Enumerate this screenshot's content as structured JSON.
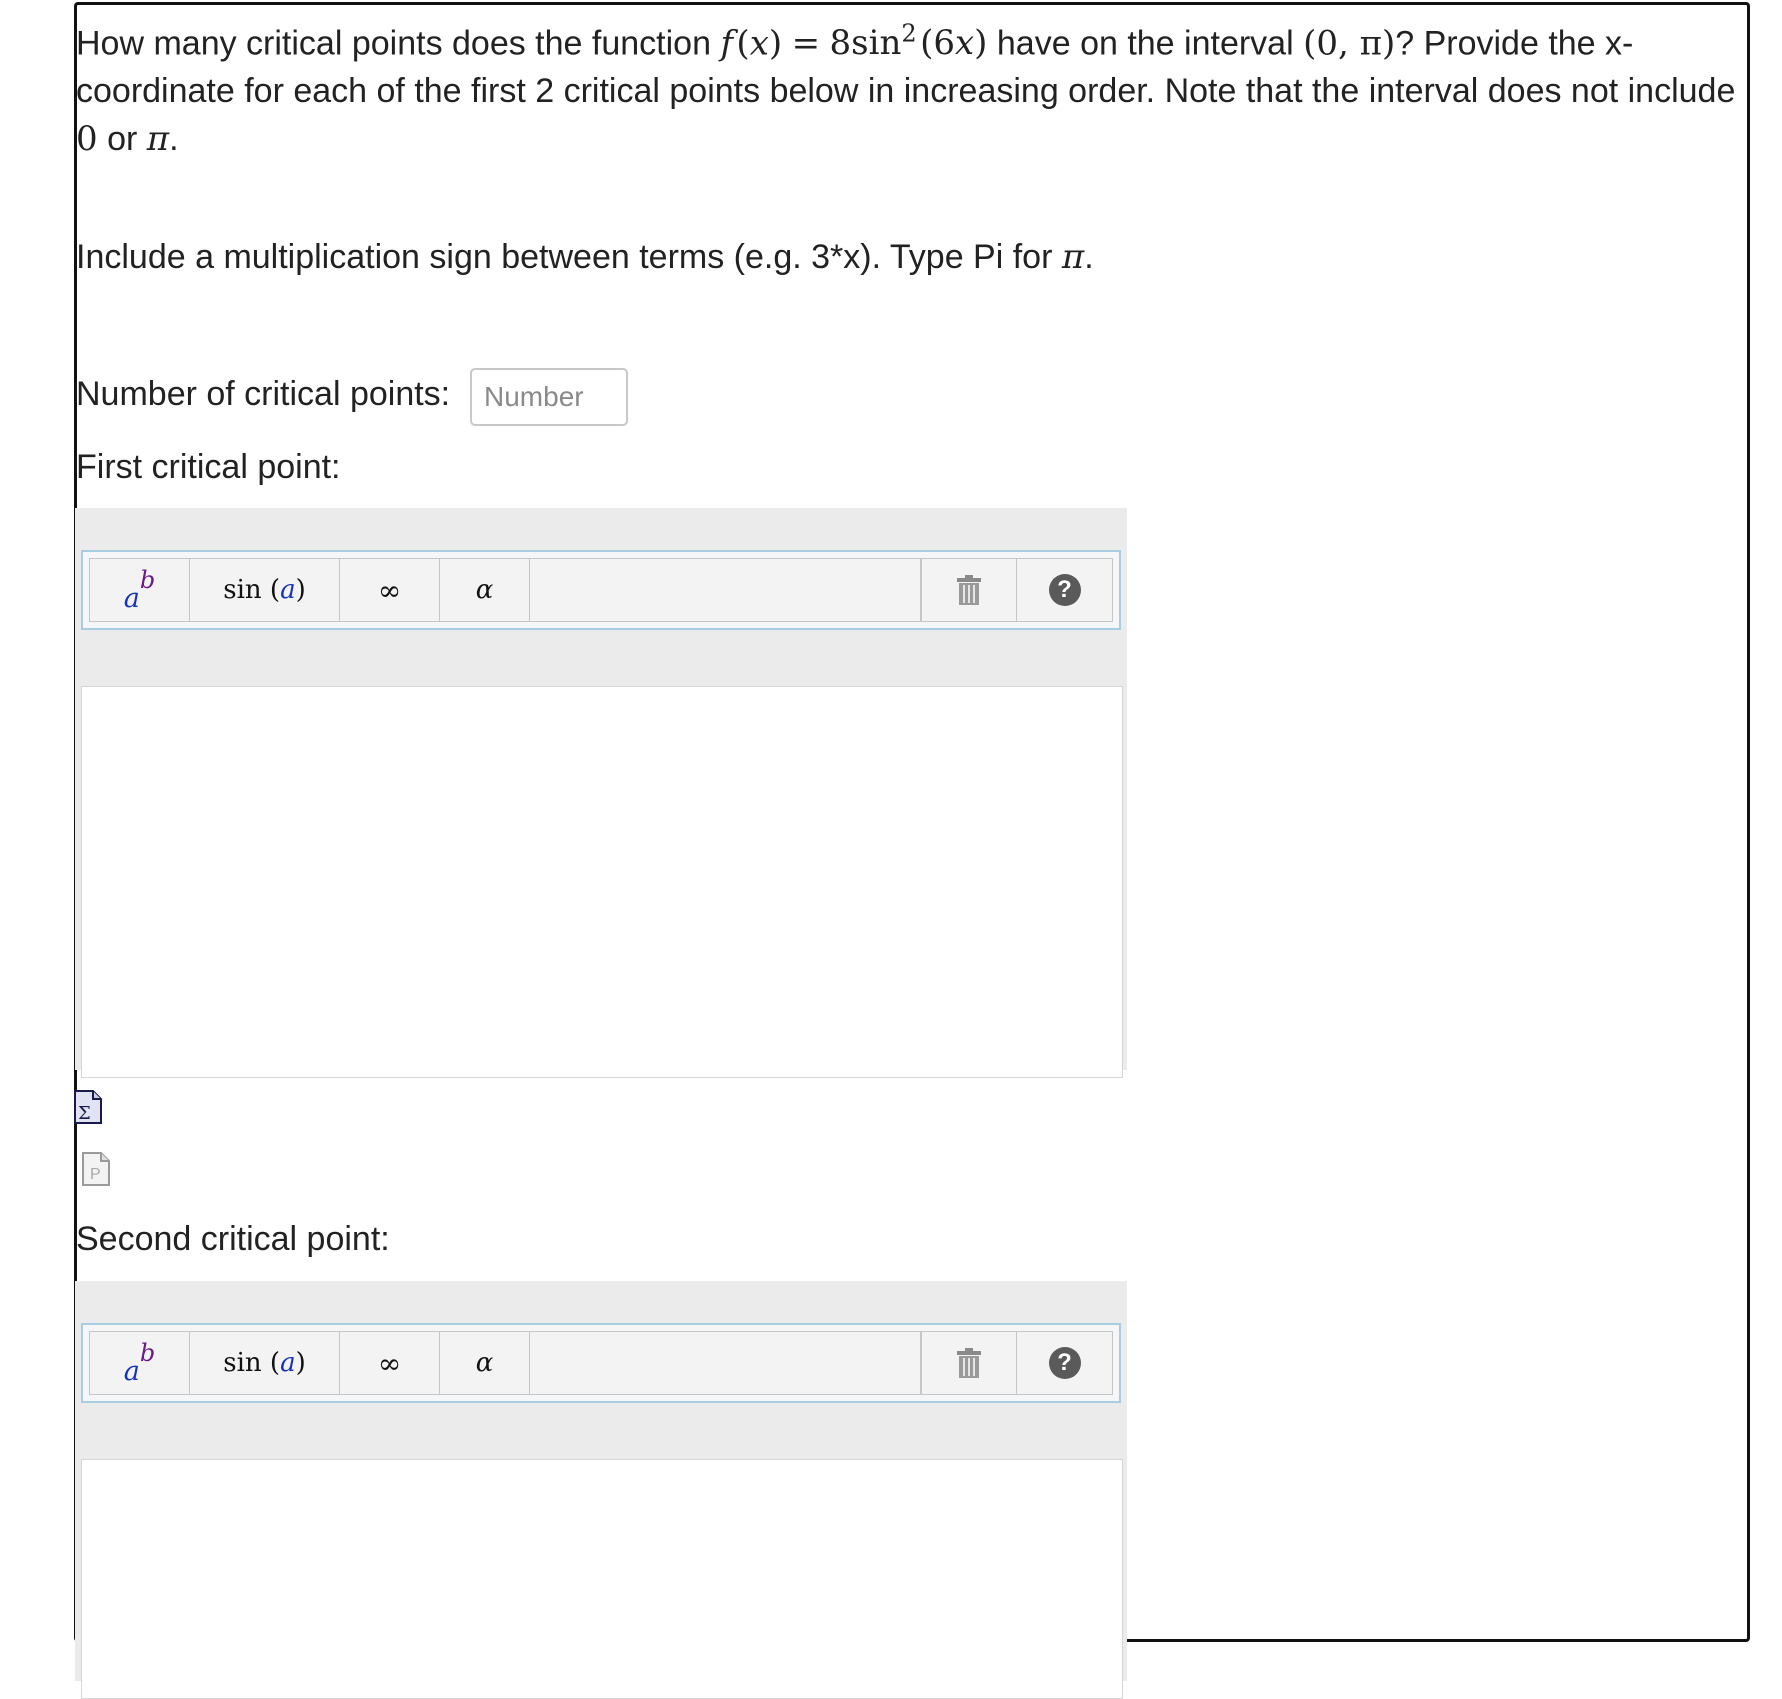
{
  "question": {
    "intro": "How many critical points does the function",
    "function_lhs": "f (x)",
    "equals": "=",
    "function_rhs": "8sin",
    "function_exp": "2",
    "function_arg": "(6x)",
    "interval_text": "have on the interval",
    "interval": "(0, π)",
    "rest": "? Provide the x-coordinate for each of the first 2 critical points below in increasing order. Note that the interval does not include",
    "zero": "0",
    "or_text": "or",
    "pi": "π",
    "period": "."
  },
  "instruction": {
    "text": "Include a multiplication sign between terms (e.g. 3*x). Type Pi for",
    "pi": "π",
    "period": "."
  },
  "count_field": {
    "label": "Number of critical points:",
    "placeholder": "Number",
    "value": ""
  },
  "editors": [
    {
      "label": "First critical point:",
      "toolbar": {
        "pow_base": "a",
        "pow_exp": "b",
        "fn_name": "sin",
        "fn_arg": "a",
        "infinity": "∞",
        "greek": "α",
        "help": "?"
      },
      "value": ""
    },
    {
      "label": "Second critical point:",
      "toolbar": {
        "pow_base": "a",
        "pow_exp": "b",
        "fn_name": "sin",
        "fn_arg": "a",
        "infinity": "∞",
        "greek": "α",
        "help": "?"
      },
      "value": ""
    }
  ],
  "icons": {
    "equation_icon": "sigma-equation-icon",
    "preview_icon": "preview-page-icon",
    "trash_icon": "trash-icon",
    "help_icon": "question-circle-icon"
  }
}
